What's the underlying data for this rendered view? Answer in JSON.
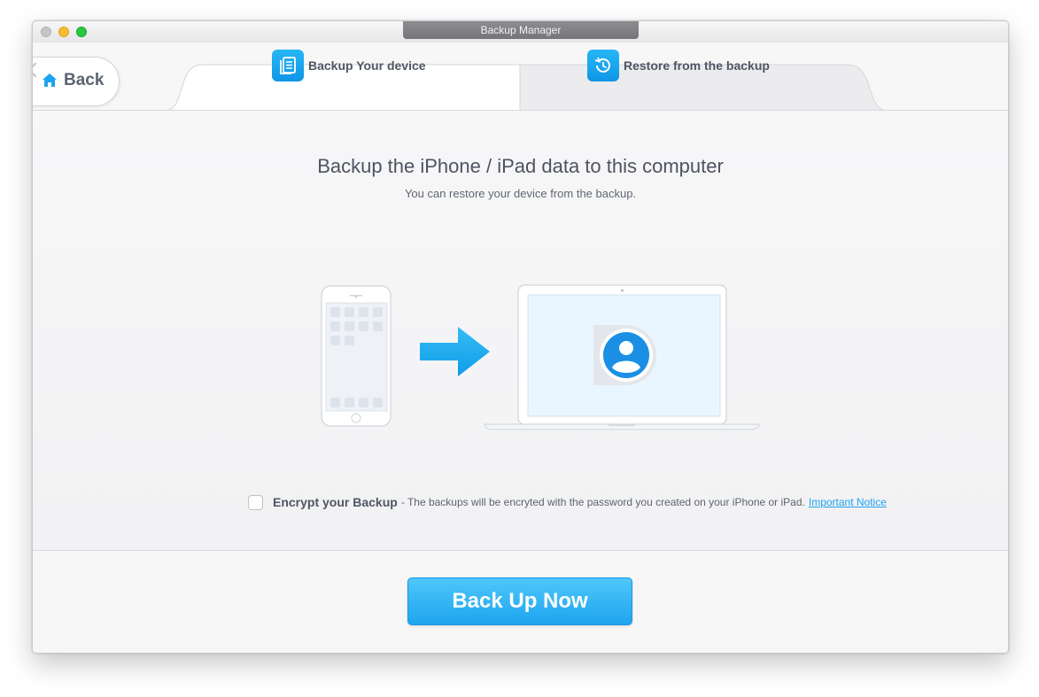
{
  "window": {
    "title": "Backup Manager"
  },
  "nav": {
    "back_label": "Back"
  },
  "tabs": [
    {
      "label": "Backup Your device",
      "icon": "backup-document-icon",
      "active": true
    },
    {
      "label": "Restore from the backup",
      "icon": "restore-clock-icon",
      "active": false
    }
  ],
  "main": {
    "heading": "Backup the iPhone / iPad data to this computer",
    "subheading": "You can restore your device from the backup."
  },
  "encrypt": {
    "checked": false,
    "label": "Encrypt your Backup",
    "description": "- The backups will be encryted with the password you created on your iPhone or iPad.",
    "link_label": "Important Notice"
  },
  "actions": {
    "primary_label": "Back Up Now"
  },
  "colors": {
    "accent": "#1ea4ee",
    "link": "#1ba1ee",
    "text": "#4e5360"
  }
}
